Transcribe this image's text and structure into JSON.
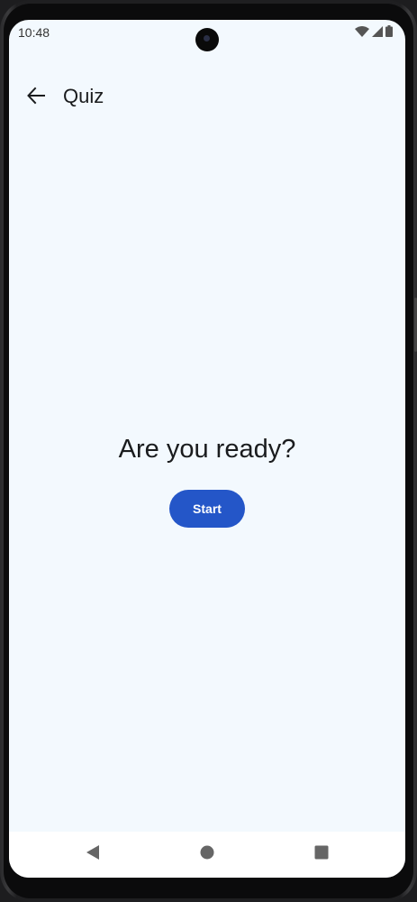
{
  "status_bar": {
    "time": "10:48",
    "icons": [
      "wifi-icon",
      "signal-icon",
      "battery-icon"
    ]
  },
  "app_bar": {
    "title": "Quiz",
    "back_icon": "arrow-back-icon"
  },
  "main": {
    "prompt": "Are you ready?",
    "start_label": "Start"
  },
  "nav_bar": {
    "icons": [
      "back-triangle-icon",
      "home-circle-icon",
      "recents-square-icon"
    ]
  },
  "colors": {
    "background": "#f3f9fe",
    "accent": "#2456c8",
    "text": "#1a1c1e"
  }
}
